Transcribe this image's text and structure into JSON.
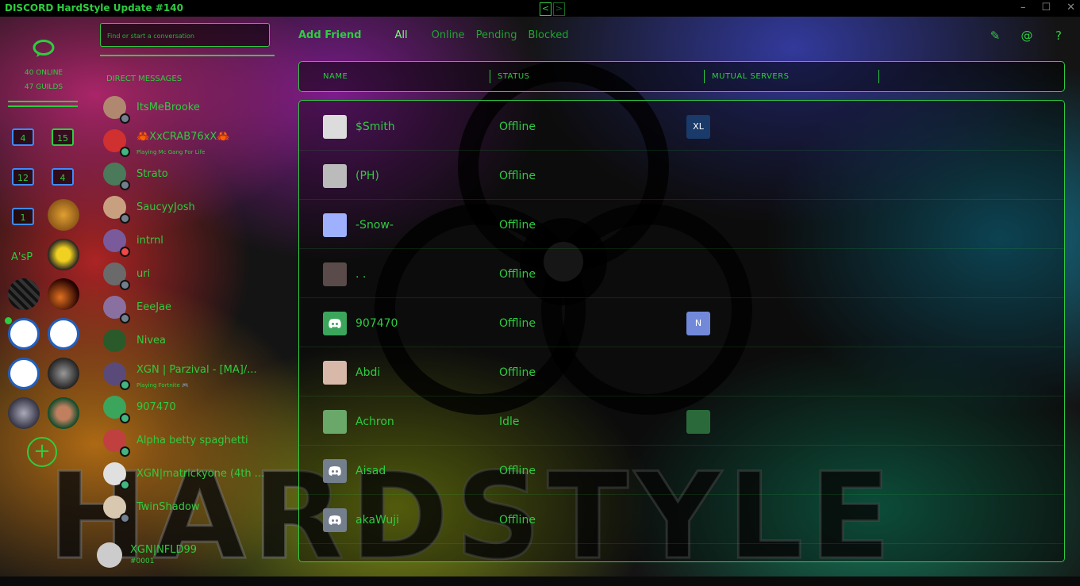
{
  "window": {
    "title": "DISCORD HardStyle Update #140",
    "nav_back": "<",
    "nav_forward": ">",
    "controls": [
      "–",
      "☐",
      "✕"
    ]
  },
  "guilds": {
    "online_count": "40 ONLINE",
    "guild_count": "47 GUILDS",
    "folders": [
      "4",
      "15",
      "12",
      "4",
      "1"
    ],
    "server_acronym": "A'sP",
    "add_label": "+"
  },
  "dm": {
    "search_placeholder": "Find or start a conversation",
    "header": "DIRECT MESSAGES",
    "items": [
      {
        "name": "ItsMeBrooke",
        "sub": "",
        "status": "offline",
        "color": "#b08870"
      },
      {
        "name": "🦀XxCRAB76xX🦀",
        "sub": "Playing Mc Gang For Life",
        "status": "online",
        "color": "#d03030"
      },
      {
        "name": "Strato",
        "sub": "",
        "status": "offline",
        "color": "#4a7a5a"
      },
      {
        "name": "SaucyyJosh",
        "sub": "",
        "status": "offline",
        "color": "#c8a080"
      },
      {
        "name": "intrnl",
        "sub": "",
        "status": "dnd",
        "color": "#7a5a9a"
      },
      {
        "name": "uri",
        "sub": "",
        "status": "offline",
        "color": "#6a6a6a"
      },
      {
        "name": "EeeJae",
        "sub": "",
        "status": "offline",
        "color": "#8a70a0"
      },
      {
        "name": "Nivea",
        "sub": "",
        "status": "none",
        "color": "#2a5a2a"
      },
      {
        "name": "XGN | Parzival - [MA]/...",
        "sub": "Playing Fortnite 🎮",
        "status": "online",
        "color": "#5a4a7a"
      },
      {
        "name": "907470",
        "sub": "",
        "status": "online",
        "color": "#3ba55c"
      },
      {
        "name": "Alpha betty spaghetti",
        "sub": "",
        "status": "online",
        "color": "#c04040"
      },
      {
        "name": "XGN|matrickyone (4th ...",
        "sub": "",
        "status": "online",
        "color": "#e0e0e0"
      },
      {
        "name": "TwinShadow",
        "sub": "",
        "status": "offline",
        "color": "#d8c8b0"
      }
    ]
  },
  "user": {
    "name": "XGN|NFLD99",
    "tag": "#0001"
  },
  "topnav": {
    "add_friend": "Add Friend",
    "all": "All",
    "online": "Online",
    "pending": "Pending",
    "blocked": "Blocked"
  },
  "top_icons": [
    "new-group-icon",
    "mention-icon",
    "help-icon"
  ],
  "table": {
    "col_name": "NAME",
    "col_status": "STATUS",
    "col_mutual": "MUTUAL SERVERS"
  },
  "friends": [
    {
      "name": "$Smith",
      "status": "Offline",
      "mutual": "XL",
      "avatar": "#dcdcdc",
      "mutual_color": "#1a3a6a"
    },
    {
      "name": "(PH)",
      "status": "Offline",
      "mutual": "",
      "avatar": "#bbbbbb"
    },
    {
      "name": "-Snow-",
      "status": "Offline",
      "mutual": "",
      "avatar": "#9fb0ff"
    },
    {
      "name": ". .",
      "status": "Offline",
      "mutual": "",
      "avatar": "#5a4a4a"
    },
    {
      "name": "907470",
      "status": "Offline",
      "mutual": "N",
      "avatar": "discord",
      "mutual_color": "#7289da"
    },
    {
      "name": "Abdi",
      "status": "Offline",
      "mutual": "",
      "avatar": "#d8b8a8"
    },
    {
      "name": "Achron",
      "status": "Idle",
      "mutual": "",
      "avatar": "#6aa86a",
      "mutual_color": "#2a6a3a",
      "mutual_img": true
    },
    {
      "name": "Aisad",
      "status": "Offline",
      "mutual": "",
      "avatar": "discord-grey"
    },
    {
      "name": "akaWuji",
      "status": "Offline",
      "mutual": "",
      "avatar": "discord-grey"
    }
  ],
  "wallpaper_text": "HARDSTYLE"
}
